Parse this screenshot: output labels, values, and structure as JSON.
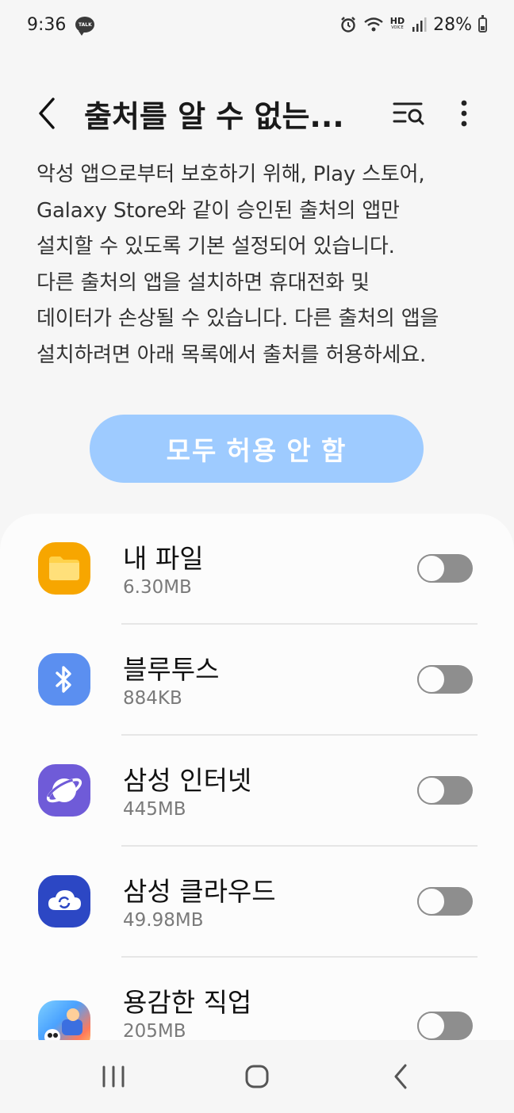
{
  "status_bar": {
    "time": "9:36",
    "talk_badge": "TALK",
    "hd_label": "HD",
    "voice_label": "VOICE",
    "battery_percent": "28%"
  },
  "app_bar": {
    "title": "출처를 알 수 없는..."
  },
  "description": [
    "악성 앱으로부터 보호하기 위해, Play 스토어,",
    "Galaxy Store와 같이 승인된 출처의 앱만",
    "설치할 수 있도록 기본 설정되어 있습니다.",
    "다른 출처의 앱을 설치하면 휴대전화 및",
    "데이터가 손상될 수 있습니다. 다른 출처의 앱을",
    "설치하려면 아래 목록에서 출처를 허용하세요."
  ],
  "deny_all_label": "모두 허용 안 함",
  "apps": [
    {
      "name": "내 파일",
      "size": "6.30MB",
      "icon": "folder-icon",
      "enabled": false
    },
    {
      "name": "블루투스",
      "size": "884KB",
      "icon": "bluetooth-icon",
      "enabled": false
    },
    {
      "name": "삼성 인터넷",
      "size": "445MB",
      "icon": "samsung-internet-icon",
      "enabled": false
    },
    {
      "name": "삼성 클라우드",
      "size": "49.98MB",
      "icon": "samsung-cloud-icon",
      "enabled": false
    },
    {
      "name": "용감한 직업",
      "size": "205MB",
      "icon": "game-icon",
      "enabled": false
    }
  ],
  "colors": {
    "background": "#f6f6f6",
    "button_disabled": "#9ecbff",
    "toggle_off": "#8e8e8e",
    "folder": "#f7a600",
    "bluetooth": "#5b8ff0",
    "internet": "#6f5bd8",
    "cloud": "#2c47c4"
  }
}
